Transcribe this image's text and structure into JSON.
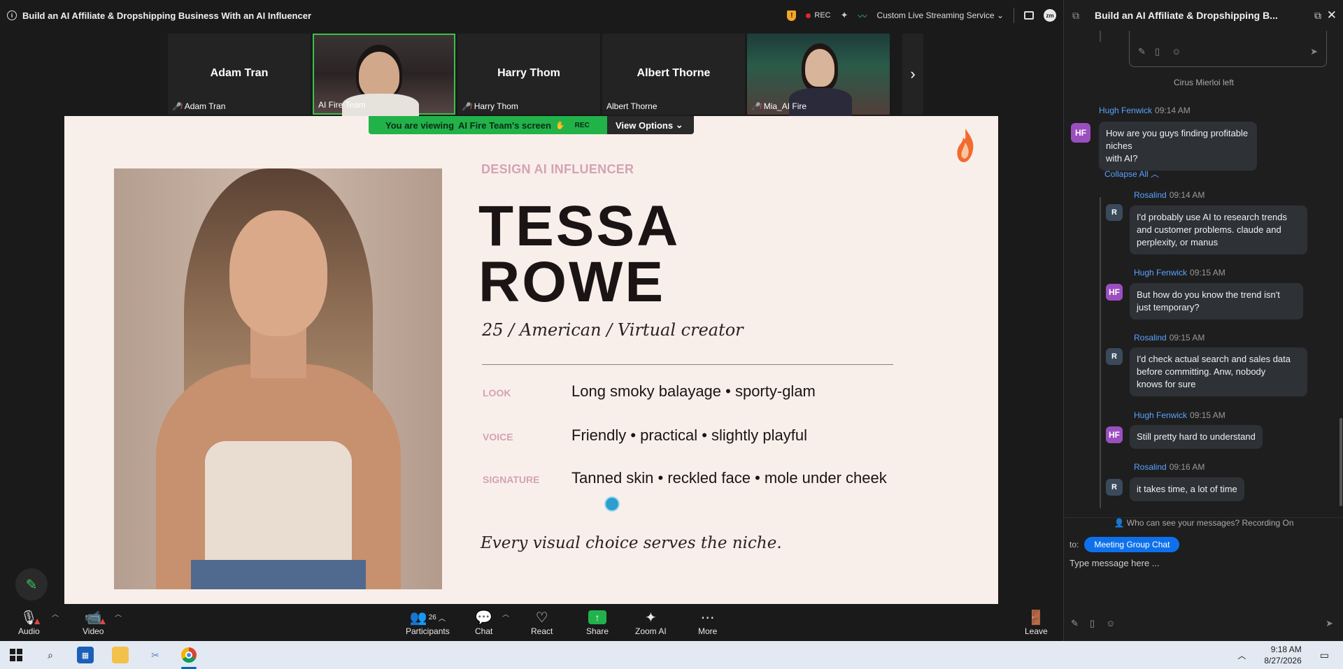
{
  "meeting": {
    "title": "Build an AI Affiliate & Dropshipping Business With an AI Influencer",
    "rec_label": "REC",
    "stream_label": "Custom Live Streaming Service",
    "zm_label": "zm"
  },
  "participants_strip": [
    {
      "center_name": "Adam Tran",
      "name": "Adam Tran",
      "muted": true
    },
    {
      "center_name": "",
      "name": "AI Fire Team",
      "muted": false
    },
    {
      "center_name": "Harry Thom",
      "name": "Harry Thom",
      "muted": true
    },
    {
      "center_name": "Albert Thorne",
      "name": "Albert Thorne",
      "muted": false
    },
    {
      "center_name": "",
      "name": "Mia_AI Fire",
      "muted": true
    }
  ],
  "viewing_bar": {
    "prefix": "You are viewing",
    "owner": "AI Fire Team's screen",
    "rec": "REC",
    "view_options": "View Options"
  },
  "slide": {
    "eyebrow": "DESIGN AI INFLUENCER",
    "name_line1": "TESSA",
    "name_line2": "ROWE",
    "subline": "25 / American / Virtual creator",
    "rows": [
      {
        "label": "LOOK",
        "value": "Long smoky balayage • sporty-glam"
      },
      {
        "label": "VOICE",
        "value": "Friendly • practical • slightly playful"
      },
      {
        "label": "SIGNATURE",
        "value": "Tanned skin •  reckled face • mole under cheek"
      }
    ],
    "tagline": "Every visual choice serves the niche."
  },
  "toolbar": {
    "audio": "Audio",
    "video": "Video",
    "participants": "Participants",
    "participants_count": "26",
    "chat": "Chat",
    "react": "React",
    "share": "Share",
    "zoom_ai": "Zoom AI",
    "more": "More",
    "leave": "Leave"
  },
  "chat": {
    "title": "Build an AI Affiliate & Dropshipping B...",
    "left_notice": "Cirus Mierloi left",
    "collapse_all": "Collapse All",
    "messages": [
      {
        "sender": "Hugh Fenwick",
        "initials": "HF",
        "time": "09:14 AM",
        "text_lines": [
          "How are you guys finding profitable niches",
          "with AI?"
        ]
      },
      {
        "sender": "Rosalind",
        "initials": "R",
        "time": "09:14 AM",
        "text_lines": [
          "I'd probably use AI to research trends",
          "and customer problems. claude and",
          "perplexity, or manus"
        ]
      },
      {
        "sender": "Hugh Fenwick",
        "initials": "HF",
        "time": "09:15 AM",
        "text_lines": [
          "But how do you know the trend isn't",
          "just temporary?"
        ]
      },
      {
        "sender": "Rosalind",
        "initials": "R",
        "time": "09:15 AM",
        "text_lines": [
          "I'd check actual search and sales data",
          "before committing. Anw, nobody",
          "knows for sure"
        ]
      },
      {
        "sender": "Hugh Fenwick",
        "initials": "HF",
        "time": "09:15 AM",
        "text_lines": [
          "Still pretty hard to understand"
        ]
      },
      {
        "sender": "Rosalind",
        "initials": "R",
        "time": "09:16 AM",
        "text_lines": [
          "it takes time, a lot of time"
        ]
      }
    ],
    "who_can_see": "Who can see your messages? Recording On",
    "to_label": "to:",
    "to_chip": "Meeting Group Chat",
    "placeholder": "Type message here ..."
  },
  "taskbar": {
    "time": "9:18 AM",
    "date": "8/27/2026"
  },
  "colors": {
    "zoom_green": "#21b24a",
    "zoom_blue": "#0e71eb",
    "slide_bg": "#f9efea",
    "slide_accent": "#d4a3b4",
    "mute_red": "#e54444"
  }
}
